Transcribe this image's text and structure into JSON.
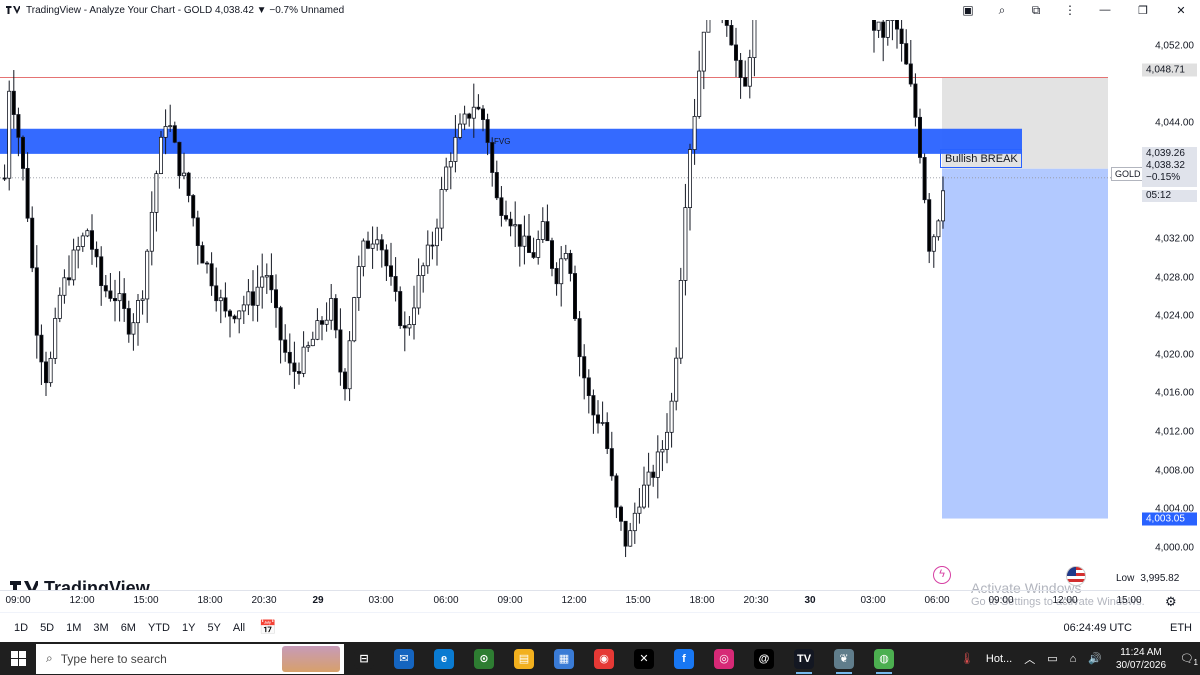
{
  "window": {
    "title": "TradingView - Analyze Your Chart - GOLD 4,038.42 ▼ −0.7% Unnamed",
    "icons": [
      "save-icon",
      "zoom-icon",
      "extension-icon",
      "menu-icon"
    ],
    "controls": [
      "minimize-icon",
      "maximize-icon",
      "close-icon"
    ]
  },
  "chart": {
    "symbol_label": "GOLD",
    "watermark": "TradingView",
    "annotation_bullish": "Bullish BREAK",
    "annotation_fvg": "FVG",
    "price_axis_labels": [
      "4,052.00",
      "4,044.00",
      "4,032.00",
      "4,028.00",
      "4,024.00",
      "4,020.00",
      "4,016.00",
      "4,012.00",
      "4,008.00",
      "4,004.00",
      "4,000.00"
    ],
    "price_tags": {
      "red_line": "4,048.71",
      "box_top": "4,039.26",
      "last_price": "4,038.32",
      "last_change": "−0.15%",
      "countdown": "05:12",
      "box_bottom": "4,003.05"
    },
    "low": {
      "label": "Low",
      "value": "3,995.82"
    },
    "time_axis_labels": [
      "09:00",
      "12:00",
      "15:00",
      "18:00",
      "20:30",
      "29",
      "03:00",
      "06:00",
      "09:00",
      "12:00",
      "15:00",
      "18:00",
      "20:30",
      "30",
      "03:00",
      "06:00",
      "09:00",
      "12:00",
      "15:00"
    ]
  },
  "overlay": {
    "activate_title": "Activate Windows",
    "activate_sub": "Go to Settings to activate Windows."
  },
  "range_bar": {
    "ranges": [
      "1D",
      "5D",
      "1M",
      "3M",
      "6M",
      "YTD",
      "1Y",
      "5Y",
      "All"
    ],
    "clock": "06:24:49 UTC",
    "session": "ETH"
  },
  "taskbar": {
    "search_placeholder": "Type here to search",
    "apps": [
      "task-view",
      "mail",
      "edge",
      "chrome-badge",
      "file-explorer",
      "store",
      "chrome",
      "x",
      "facebook",
      "instagram",
      "threads",
      "tradingview",
      "app-bird",
      "app-globe"
    ],
    "weather": "Hot...",
    "time": "11:24 AM",
    "date": "30/07/2026",
    "notification_count": "1"
  },
  "colors": {
    "bull": "#ffffff",
    "bear": "#000000",
    "zone_blue": "#2962ff",
    "target_box": "#aec6ff",
    "stop_box": "#e0e0e0",
    "resistance_line": "#e57373"
  },
  "chart_data": {
    "type": "candlestick",
    "symbol": "GOLD",
    "price_range": [
      3995.82,
      4053
    ],
    "levels": {
      "resistance": 4048.71,
      "fvg_zone": [
        4040.8,
        4043.4
      ],
      "box_top": 4039.26,
      "box_bottom": 4003.05,
      "last": 4038.32,
      "low": 3995.82
    }
  }
}
